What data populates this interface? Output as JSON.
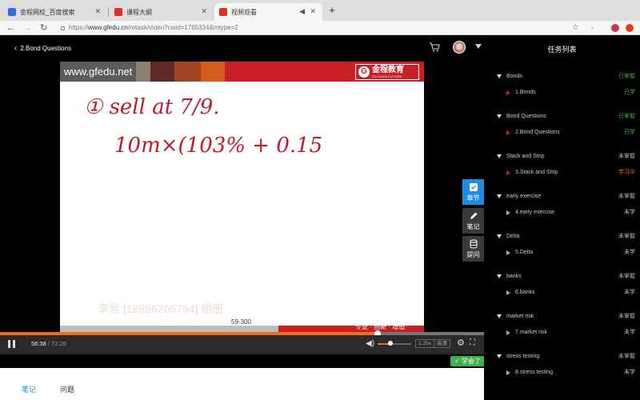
{
  "browser": {
    "tabs": [
      {
        "title": "金程网校_百度搜索",
        "icon": "baidu-paw-icon",
        "color": "#2f6fe0"
      },
      {
        "title": "课程大纲",
        "icon": "gfedu-logo-icon",
        "color": "#e0301e"
      },
      {
        "title": "视频观看",
        "icon": "gfedu-logo-icon",
        "color": "#e0301e"
      }
    ],
    "active_tab": 2,
    "url_prefix": "https://",
    "url_host": "www.gfedu.cn",
    "url_path": "/retask/video?cwid=1765334&mtype=2"
  },
  "course": {
    "back_label": "2.Bond Questions"
  },
  "video": {
    "site_label": "www.gfedu.net",
    "logo_cn": "金程教育",
    "logo_en": "GOLDEN FUTURE",
    "handwriting_line1": "① sell at 7/9.",
    "handwriting_line2": "10m×(103% + 0.15%)",
    "watermark": "李易 [18996206794] 相册",
    "page_num": "59-300",
    "slogan": "专业 · 创新 · 增值",
    "current_time": "56:38",
    "total_time": "/ 72:26",
    "progress": 0.78,
    "volume": 0.38,
    "speed": "1.25x",
    "quality": "高清",
    "learned_label": "学会了",
    "side_buttons": {
      "chapter": "章节",
      "notes": "笔记",
      "ask": "提问"
    }
  },
  "bottom_tabs": {
    "notes": "笔记",
    "questions": "问题"
  },
  "tasks": {
    "title": "任务列表",
    "sections": [
      {
        "name": "Bonds",
        "status": "已掌握",
        "status_color": "green",
        "item": "1.Bonds",
        "item_status": "已学",
        "item_status_color": "green",
        "play_color": "red"
      },
      {
        "name": "Bond Questions",
        "status": "已掌握",
        "status_color": "green",
        "item": "2.Bond Questions",
        "item_status": "已学",
        "item_status_color": "green",
        "play_color": "red"
      },
      {
        "name": "Stack and Strip",
        "status": "未掌握",
        "status_color": "grey",
        "item": "3.Stack and Strip",
        "item_status": "学习中",
        "item_status_color": "orange",
        "play_color": "red"
      },
      {
        "name": "early exercise",
        "status": "未掌握",
        "status_color": "grey",
        "item": "4.early exercise",
        "item_status": "未学",
        "item_status_color": "grey",
        "play_color": "grey"
      },
      {
        "name": "Delta",
        "status": "未掌握",
        "status_color": "grey",
        "item": "5.Delta",
        "item_status": "未学",
        "item_status_color": "grey",
        "play_color": "grey"
      },
      {
        "name": "banks",
        "status": "未掌握",
        "status_color": "grey",
        "item": "6.banks",
        "item_status": "未学",
        "item_status_color": "grey",
        "play_color": "grey"
      },
      {
        "name": "market risk",
        "status": "未掌握",
        "status_color": "grey",
        "item": "7.market risk",
        "item_status": "未学",
        "item_status_color": "grey",
        "play_color": "grey"
      },
      {
        "name": "stress testing",
        "status": "未掌握",
        "status_color": "grey",
        "item": "8.stress testing",
        "item_status": "未学",
        "item_status_color": "grey",
        "play_color": "grey"
      }
    ]
  }
}
